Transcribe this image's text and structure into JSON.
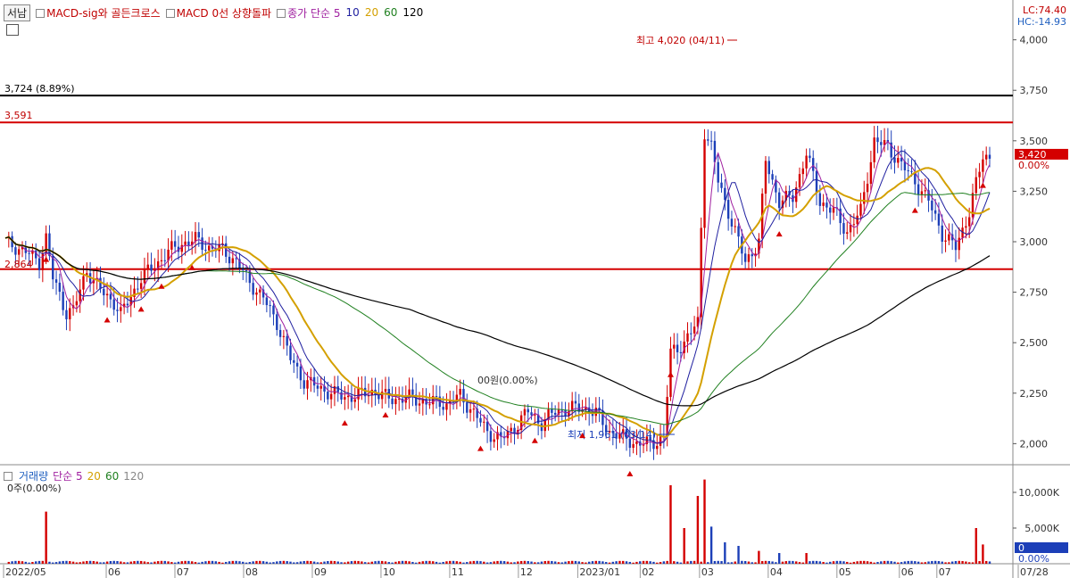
{
  "window": {
    "tab_label": "서남",
    "legend": [
      {
        "label": "MACD-sig와 골든크로스",
        "color": "#c00000"
      },
      {
        "label": "MACD 0선 상향돌파",
        "color": "#c00000"
      },
      {
        "label": "종가 단순 5",
        "color": "#a020a0"
      }
    ],
    "ma_periods": [
      {
        "label": "10",
        "color": "#2020a0"
      },
      {
        "label": "20",
        "color": "#d4a000"
      },
      {
        "label": "60",
        "color": "#208020"
      },
      {
        "label": "120",
        "color": "#000000"
      }
    ]
  },
  "right_panel": {
    "lc": "LC:74.40",
    "hc": "HC:-14.93",
    "current_price": "3,420",
    "current_pct": "0.00%",
    "vol_current": "0",
    "vol_pct": "0.00%"
  },
  "annotations": {
    "high": "최고 4,020 (04/11)",
    "low": "최저 1,961 (03/14)",
    "line_top": "3,724 (8.89%)",
    "line_red": "3,591",
    "line_support": "2,864",
    "mid_label": "00원(0.00%)"
  },
  "volume_panel": {
    "title": "거래량",
    "ma_label": "단순 5",
    "periods": [
      {
        "label": "20",
        "color": "#d4a000"
      },
      {
        "label": "60",
        "color": "#208020"
      },
      {
        "label": "120",
        "color": "#888888"
      }
    ],
    "sub": "0주(0.00%)"
  },
  "chart_data": {
    "type": "candlestick",
    "price_axis": {
      "ticks": [
        2000,
        2250,
        2500,
        2750,
        3000,
        3250,
        3500,
        3750,
        4000
      ],
      "tick_labels": [
        "2,000",
        "2,250",
        "2,500",
        "2,750",
        "3,000",
        "3,250",
        "3,500",
        "3,750",
        "4,000"
      ],
      "ylim": [
        1900,
        4100
      ]
    },
    "volume_axis": {
      "ticks": [
        0,
        5000,
        10000
      ],
      "tick_labels": [
        "0",
        "5,000K",
        "10,000K"
      ],
      "ylim": [
        0,
        11500
      ]
    },
    "x_axis": {
      "labels": [
        "2022/05",
        "06",
        "07",
        "08",
        "09",
        "10",
        "11",
        "12",
        "2023/01",
        "02",
        "03",
        "04",
        "05",
        "06",
        "07",
        "07/28"
      ]
    },
    "horizontal_lines": [
      {
        "value": 3724,
        "color": "#000000"
      },
      {
        "value": 3591,
        "color": "#d40000"
      },
      {
        "value": 2864,
        "color": "#d40000"
      }
    ],
    "price_anchors": [
      [
        0,
        3000
      ],
      [
        6,
        2950
      ],
      [
        10,
        2900
      ],
      [
        12,
        3020
      ],
      [
        14,
        2820
      ],
      [
        18,
        2650
      ],
      [
        20,
        2660
      ],
      [
        24,
        2860
      ],
      [
        28,
        2760
      ],
      [
        32,
        2700
      ],
      [
        34,
        2640
      ],
      [
        38,
        2760
      ],
      [
        40,
        2820
      ],
      [
        44,
        2880
      ],
      [
        48,
        2950
      ],
      [
        52,
        2990
      ],
      [
        56,
        3010
      ],
      [
        60,
        2970
      ],
      [
        64,
        2960
      ],
      [
        68,
        2900
      ],
      [
        72,
        2800
      ],
      [
        76,
        2720
      ],
      [
        80,
        2600
      ],
      [
        84,
        2420
      ],
      [
        88,
        2310
      ],
      [
        92,
        2280
      ],
      [
        96,
        2250
      ],
      [
        100,
        2230
      ],
      [
        104,
        2240
      ],
      [
        108,
        2260
      ],
      [
        112,
        2230
      ],
      [
        116,
        2220
      ],
      [
        120,
        2230
      ],
      [
        124,
        2200
      ],
      [
        128,
        2210
      ],
      [
        130,
        2190
      ],
      [
        134,
        2240
      ],
      [
        138,
        2150
      ],
      [
        142,
        2060
      ],
      [
        146,
        2020
      ],
      [
        150,
        2080
      ],
      [
        154,
        2160
      ],
      [
        158,
        2100
      ],
      [
        162,
        2160
      ],
      [
        166,
        2170
      ],
      [
        170,
        2180
      ],
      [
        174,
        2150
      ],
      [
        178,
        2060
      ],
      [
        182,
        2030
      ],
      [
        186,
        2000
      ],
      [
        190,
        2000
      ],
      [
        194,
        2030
      ],
      [
        196,
        2450
      ],
      [
        200,
        2500
      ],
      [
        204,
        2600
      ],
      [
        206,
        3550
      ],
      [
        208,
        3470
      ],
      [
        210,
        3300
      ],
      [
        212,
        3200
      ],
      [
        214,
        3100
      ],
      [
        218,
        2900
      ],
      [
        222,
        3000
      ],
      [
        224,
        3400
      ],
      [
        228,
        3200
      ],
      [
        232,
        3220
      ],
      [
        236,
        3440
      ],
      [
        240,
        3200
      ],
      [
        244,
        3150
      ],
      [
        248,
        3050
      ],
      [
        252,
        3150
      ],
      [
        256,
        3500
      ],
      [
        260,
        3470
      ],
      [
        264,
        3380
      ],
      [
        268,
        3300
      ],
      [
        272,
        3200
      ],
      [
        276,
        3040
      ],
      [
        280,
        2970
      ],
      [
        284,
        3150
      ],
      [
        288,
        3420
      ]
    ],
    "volume_spikes": [
      [
        12,
        7300
      ],
      [
        196,
        11000
      ],
      [
        200,
        5000
      ],
      [
        204,
        9500
      ],
      [
        206,
        11800
      ],
      [
        208,
        5200
      ],
      [
        212,
        3000
      ],
      [
        216,
        2500
      ],
      [
        222,
        1800
      ],
      [
        228,
        1500
      ],
      [
        236,
        1500
      ],
      [
        286,
        5000
      ],
      [
        288,
        2700
      ]
    ]
  }
}
